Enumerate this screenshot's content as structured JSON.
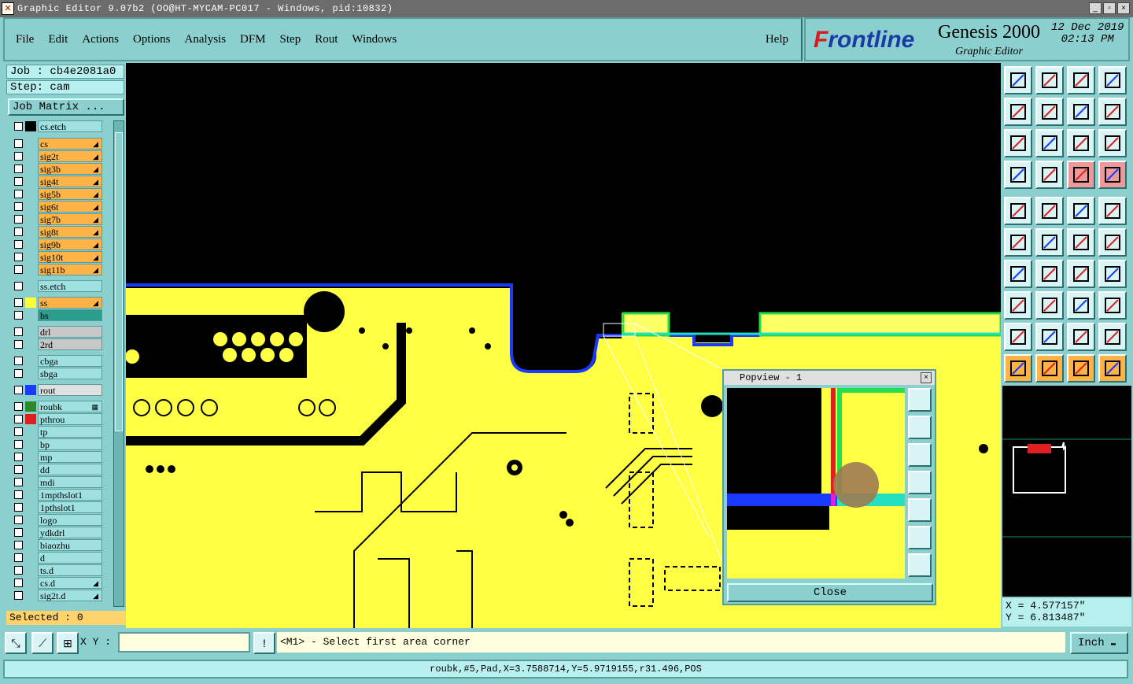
{
  "window": {
    "title": "Graphic Editor 9.07b2 (OO@HT-MYCAM-PC017 - Windows, pid:10832)",
    "minimize": "_",
    "maximize": "▫",
    "close": "×"
  },
  "menu": {
    "items": [
      "File",
      "Edit",
      "Actions",
      "Options",
      "Analysis",
      "DFM",
      "Step",
      "Rout",
      "Windows"
    ],
    "help": "Help"
  },
  "brand": {
    "logo_a": "F",
    "logo_b": "rontline",
    "product": "Genesis 2000",
    "subtitle": "Graphic Editor",
    "date": "12 Dec 2019",
    "time": "02:13 PM"
  },
  "job": {
    "job_line": "Job : cb4e2081a0",
    "step_line": "Step: cam",
    "matrix_button": "Job Matrix ..."
  },
  "layers": [
    {
      "name": "cs.etch",
      "color": "#9fe0e0",
      "swatch": "#000000",
      "arrow": ""
    },
    {
      "name": "cs",
      "color": "#ffb347",
      "swatch": "",
      "arrow": "◢"
    },
    {
      "name": "sig2t",
      "color": "#ffb347",
      "swatch": "",
      "arrow": "◢"
    },
    {
      "name": "sig3b",
      "color": "#ffb347",
      "swatch": "",
      "arrow": "◢"
    },
    {
      "name": "sig4t",
      "color": "#ffb347",
      "swatch": "",
      "arrow": "◢"
    },
    {
      "name": "sig5b",
      "color": "#ffb347",
      "swatch": "",
      "arrow": "◢"
    },
    {
      "name": "sig6t",
      "color": "#ffb347",
      "swatch": "",
      "arrow": "◢"
    },
    {
      "name": "sig7b",
      "color": "#ffb347",
      "swatch": "",
      "arrow": "◢"
    },
    {
      "name": "sig8t",
      "color": "#ffb347",
      "swatch": "",
      "arrow": "◢"
    },
    {
      "name": "sig9b",
      "color": "#ffb347",
      "swatch": "",
      "arrow": "◢"
    },
    {
      "name": "sig10t",
      "color": "#ffb347",
      "swatch": "",
      "arrow": "◢"
    },
    {
      "name": "sig11b",
      "color": "#ffb347",
      "swatch": "",
      "arrow": "◢"
    },
    {
      "name": "ss.etch",
      "color": "#9fe0e0",
      "swatch": "",
      "arrow": ""
    },
    {
      "name": "ss",
      "color": "#ffb347",
      "swatch": "#ffff33",
      "arrow": "◢"
    },
    {
      "name": "bs",
      "color": "#2a9d8f",
      "swatch": "",
      "arrow": ""
    },
    {
      "name": "drl",
      "color": "#c8c8c8",
      "swatch": "",
      "arrow": ""
    },
    {
      "name": "2rd",
      "color": "#c8c8c8",
      "swatch": "",
      "arrow": ""
    },
    {
      "name": "cbga",
      "color": "#9fe0e0",
      "swatch": "",
      "arrow": ""
    },
    {
      "name": "sbga",
      "color": "#9fe0e0",
      "swatch": "",
      "arrow": ""
    },
    {
      "name": "rout",
      "color": "#e0e0e0",
      "swatch": "#1a3aff",
      "arrow": ""
    },
    {
      "name": "roubk",
      "color": "#9fe0e0",
      "swatch": "#2a8a2a",
      "arrow": "▦"
    },
    {
      "name": "pthrou",
      "color": "#9fe0e0",
      "swatch": "#e02020",
      "arrow": ""
    },
    {
      "name": "tp",
      "color": "#9fe0e0",
      "swatch": "",
      "arrow": ""
    },
    {
      "name": "bp",
      "color": "#9fe0e0",
      "swatch": "",
      "arrow": ""
    },
    {
      "name": "mp",
      "color": "#9fe0e0",
      "swatch": "",
      "arrow": ""
    },
    {
      "name": "dd",
      "color": "#9fe0e0",
      "swatch": "",
      "arrow": ""
    },
    {
      "name": "mdi",
      "color": "#9fe0e0",
      "swatch": "",
      "arrow": ""
    },
    {
      "name": "1mpthslot1",
      "color": "#9fe0e0",
      "swatch": "",
      "arrow": ""
    },
    {
      "name": "1pthslot1",
      "color": "#9fe0e0",
      "swatch": "",
      "arrow": ""
    },
    {
      "name": "logo",
      "color": "#9fe0e0",
      "swatch": "",
      "arrow": ""
    },
    {
      "name": "ydkdrl",
      "color": "#9fe0e0",
      "swatch": "",
      "arrow": ""
    },
    {
      "name": "biaozhu",
      "color": "#9fe0e0",
      "swatch": "",
      "arrow": ""
    },
    {
      "name": "d",
      "color": "#9fe0e0",
      "swatch": "",
      "arrow": ""
    },
    {
      "name": "ts.d",
      "color": "#9fe0e0",
      "swatch": "",
      "arrow": ""
    },
    {
      "name": "cs.d",
      "color": "#9fe0e0",
      "swatch": "",
      "arrow": "◢"
    },
    {
      "name": "sig2t.d",
      "color": "#9fe0e0",
      "swatch": "",
      "arrow": "◢"
    }
  ],
  "selected": "Selected : 0",
  "popview": {
    "title": "Popview - 1",
    "close_label": "Close",
    "close_x": "×"
  },
  "coords": {
    "x": "X = 4.577157\"",
    "y": "Y = 6.813487\""
  },
  "bottom": {
    "xy_label": "X Y :",
    "xy_value": "",
    "excl": "!",
    "prompt": "<M1> - Select first area corner",
    "unit": "Inch"
  },
  "status": "roubk,#5,Pad,X=3.7588714,Y=5.9719155,r31.496,POS",
  "colors": {
    "board": "#ffff44",
    "rout": "#1a3aff",
    "accent": "#8ccfcf"
  }
}
